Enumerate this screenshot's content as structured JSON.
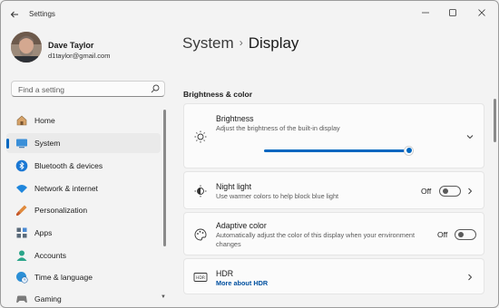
{
  "app": {
    "title": "Settings"
  },
  "profile": {
    "name": "Dave Taylor",
    "email": "d1taylor@gmail.com"
  },
  "search": {
    "placeholder": "Find a setting"
  },
  "sidebar": {
    "items": [
      {
        "label": "Home",
        "icon": "home-icon"
      },
      {
        "label": "System",
        "icon": "system-display-icon",
        "selected": true
      },
      {
        "label": "Bluetooth & devices",
        "icon": "bluetooth-icon"
      },
      {
        "label": "Network & internet",
        "icon": "wifi-icon"
      },
      {
        "label": "Personalization",
        "icon": "brush-icon"
      },
      {
        "label": "Apps",
        "icon": "apps-icon"
      },
      {
        "label": "Accounts",
        "icon": "account-icon"
      },
      {
        "label": "Time & language",
        "icon": "globe-clock-icon"
      },
      {
        "label": "Gaming",
        "icon": "game-controller-icon"
      }
    ]
  },
  "breadcrumb": {
    "parent": "System",
    "separator": "›",
    "current": "Display"
  },
  "section": {
    "title": "Brightness & color"
  },
  "cards": {
    "brightness": {
      "title": "Brightness",
      "subtitle": "Adjust the brightness of the built-in display",
      "level": 0.97
    },
    "night_light": {
      "title": "Night light",
      "subtitle": "Use warmer colors to help block blue light",
      "state_label": "Off",
      "on": false
    },
    "adaptive_color": {
      "title": "Adaptive color",
      "subtitle": "Automatically adjust the color of this display when your environment changes",
      "state_label": "Off",
      "on": false
    },
    "hdr": {
      "title": "HDR",
      "link": "More about HDR",
      "badge": "HDR"
    }
  },
  "colors": {
    "accent": "#0067c0",
    "window_bg": "#f3f3f3",
    "card_bg": "#fbfbfb"
  }
}
